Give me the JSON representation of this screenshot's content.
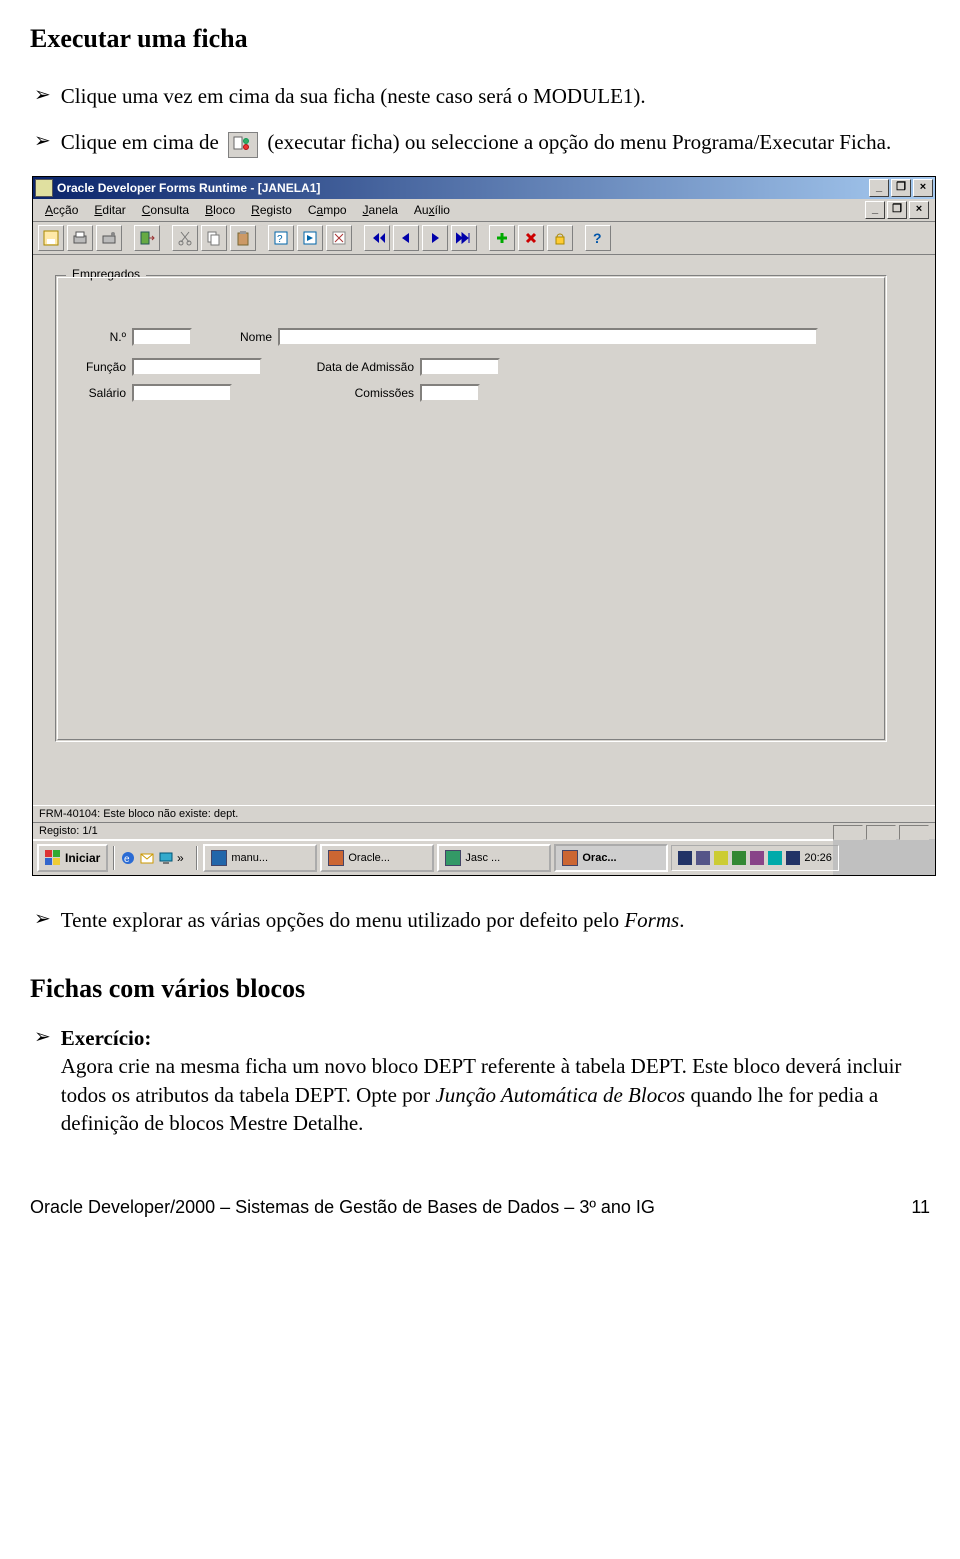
{
  "heading1": "Executar uma ficha",
  "bullet1": "Clique uma vez em cima da sua ficha (neste caso será o MODULE1).",
  "bullet2_pre": "Clique em cima de ",
  "bullet2_post": " (executar ficha) ou seleccione a opção do menu Programa/Executar Ficha.",
  "window": {
    "title": "Oracle Developer Forms Runtime - [JANELA1]",
    "menus": [
      "Acção",
      "Editar",
      "Consulta",
      "Bloco",
      "Registo",
      "Campo",
      "Janela",
      "Auxílio"
    ],
    "group_title": "Empregados",
    "fields": {
      "numero_label": "N.º",
      "nome_label": "Nome",
      "funcao_label": "Função",
      "data_adm_label": "Data de Admissão",
      "salario_label": "Salário",
      "comissoes_label": "Comissões"
    },
    "status1": "FRM-40104: Este bloco não existe: dept.",
    "status2": "Registo: 1/1"
  },
  "taskbar": {
    "start": "Iniciar",
    "items": [
      "manu...",
      "Oracle...",
      "Jasc ...",
      "Orac..."
    ],
    "clock": "20:26"
  },
  "bullet3_pre": "Tente explorar as várias opções do menu utilizado por defeito pelo ",
  "bullet3_italic": "Forms",
  "bullet3_post": ".",
  "heading2": "Fichas com vários blocos",
  "exercise_label": "Exercício:",
  "exercise_text_pre": "Agora crie na mesma ficha um novo bloco DEPT referente à tabela DEPT. Este bloco deverá incluir todos os atributos da tabela DEPT. Opte por ",
  "exercise_text_italic": "Junção Automática de Blocos",
  "exercise_text_post": " quando lhe for pedia a definição de blocos Mestre Detalhe.",
  "footer_left": "Oracle Developer/2000 – Sistemas de Gestão de Bases de Dados – 3º ano IG",
  "footer_right": "11"
}
